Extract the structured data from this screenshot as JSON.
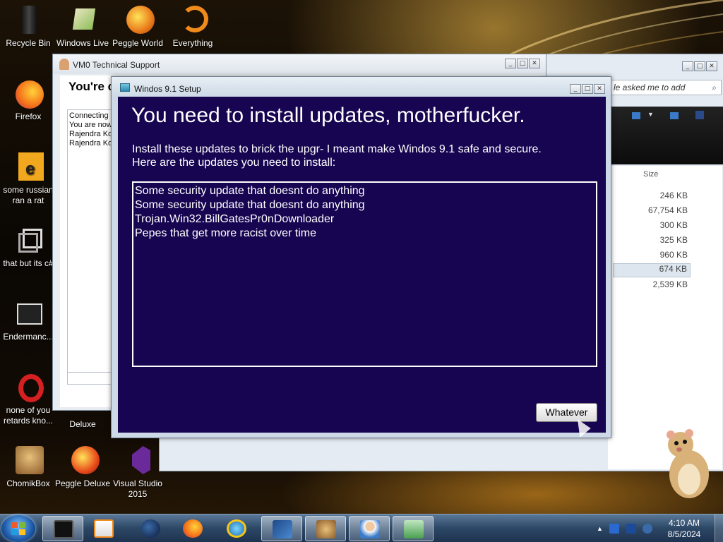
{
  "desktop": {
    "icons": [
      {
        "label": "Recycle Bin"
      },
      {
        "label": "Windows Live"
      },
      {
        "label": "Peggle World"
      },
      {
        "label": "Everything"
      },
      {
        "label": "Firefox"
      },
      {
        "label": "some russian ran a rat"
      },
      {
        "label": "that but its c#"
      },
      {
        "label": "Endermanc..."
      },
      {
        "label": "none of you retards kno..."
      },
      {
        "label": "Deluxe"
      },
      {
        "label": "ChomikBox"
      },
      {
        "label": "Peggle Deluxe"
      },
      {
        "label": "Visual Studio 2015"
      }
    ]
  },
  "vm0_window": {
    "title": "VM0 Technical Support",
    "heading": "You're c",
    "log_lines": [
      "Connecting t",
      "You are now",
      "Rajendra Kot",
      "Rajendra Kot"
    ]
  },
  "explorer": {
    "search_placeholder": "le asked me to add",
    "size_header": "Size",
    "sizes": [
      "246 KB",
      "67,754 KB",
      "300 KB",
      "325 KB",
      "960 KB",
      "674 KB",
      "2,539 KB"
    ]
  },
  "setup_window": {
    "title": "Windos 9.1 Setup",
    "heading": "You need to install updates, motherfucker.",
    "description_line1": "Install these updates to brick the upgr- I meant make Windos 9.1 safe and secure.",
    "description_line2": "Here are the updates you need to install:",
    "updates": [
      "Some security update that doesnt do anything",
      "Some security update that doesnt do anything",
      "Trojan.Win32.BillGatesPr0nDownloader",
      "Pepes that get more racist over time"
    ],
    "button_label": "Whatever"
  },
  "window_buttons": {
    "minimize": "_",
    "maximize": "□",
    "close": "✕"
  },
  "taskbar": {
    "time": "4:10 AM",
    "date": "8/5/2024",
    "tray_arrow": "▲"
  },
  "colors": {
    "setup_background": "#170551",
    "setup_text": "#ffffff",
    "taskbar": "#2c4766"
  }
}
